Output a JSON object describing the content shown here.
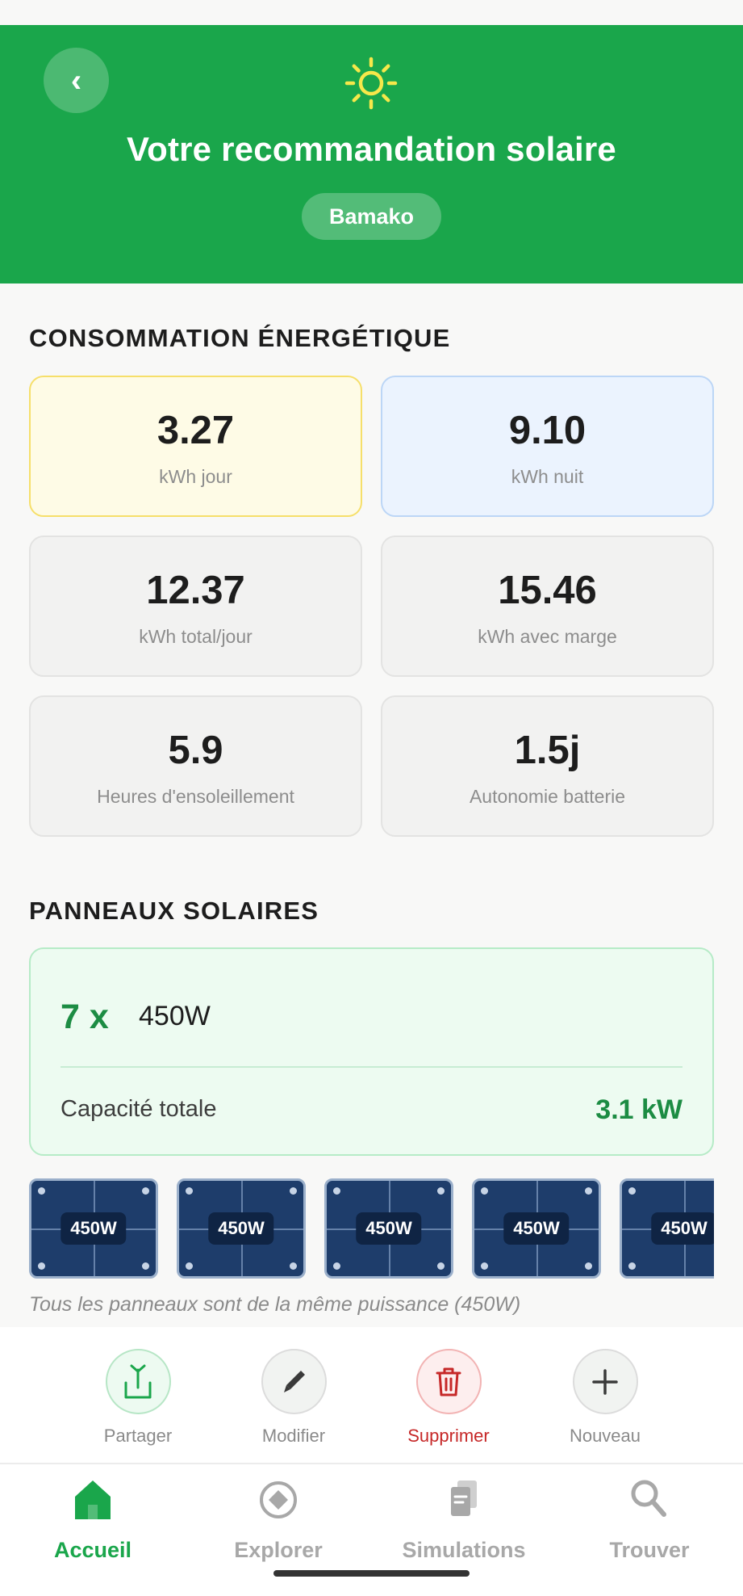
{
  "header": {
    "back_label": "‹",
    "title": "Votre recommandation solaire",
    "city": "Bamako",
    "icon": "sun-icon",
    "color": "#1aa64b"
  },
  "consumption": {
    "section_title": "CONSOMMATION ÉNERGÉTIQUE",
    "cards": [
      {
        "value": "3.27",
        "label": "kWh jour"
      },
      {
        "value": "9.10",
        "label": "kWh nuit"
      },
      {
        "value": "12.37",
        "label": "kWh total/jour"
      },
      {
        "value": "15.46",
        "label": "kWh avec marge"
      },
      {
        "value": "5.9",
        "label": "Heures d'ensoleillement"
      },
      {
        "value": "1.5j",
        "label": "Autonomie batterie"
      }
    ]
  },
  "panels": {
    "section_title": "PANNEAUX SOLAIRES",
    "count": "7 x",
    "power": "450W",
    "capacity_label": "Capacité totale",
    "capacity_value": "3.1 kW",
    "items": [
      "450W",
      "450W",
      "450W",
      "450W",
      "450W"
    ],
    "note": "Tous les panneaux sont de la même puissance (450W)"
  },
  "actions": [
    {
      "label": "Partager",
      "icon": "share-icon"
    },
    {
      "label": "Modifier",
      "icon": "pencil-icon"
    },
    {
      "label": "Supprimer",
      "icon": "trash-icon"
    },
    {
      "label": "Nouveau",
      "icon": "plus-icon"
    }
  ],
  "nav": [
    {
      "label": "Accueil",
      "icon": "home-icon",
      "active": true
    },
    {
      "label": "Explorer",
      "icon": "compass-icon",
      "active": false
    },
    {
      "label": "Simulations",
      "icon": "documents-icon",
      "active": false
    },
    {
      "label": "Trouver",
      "icon": "search-icon",
      "active": false
    }
  ],
  "colors": {
    "primary": "#1aa64b",
    "danger": "#c62828",
    "day_card": "#fefbe6",
    "night_card": "#ebf3fe",
    "panel_blue": "#1e3d6b"
  }
}
